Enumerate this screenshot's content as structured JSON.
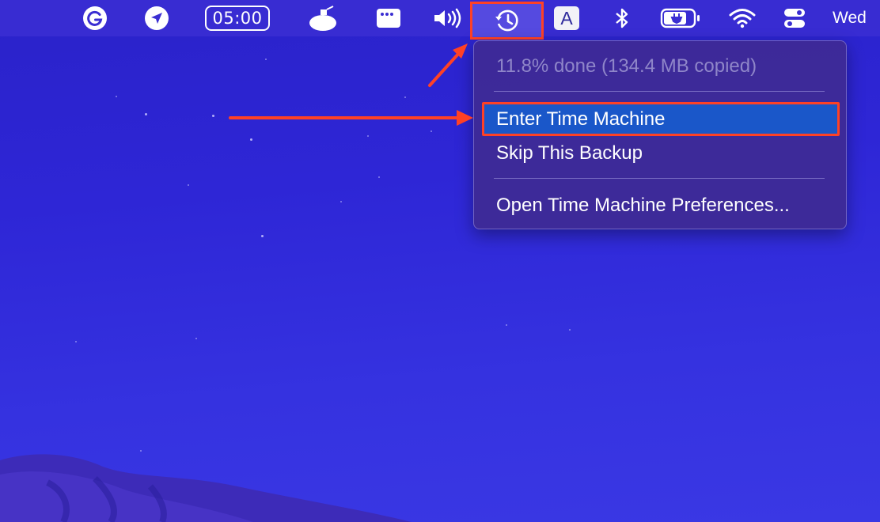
{
  "menubar": {
    "items": [
      {
        "name": "grammarly-icon"
      },
      {
        "name": "location-icon"
      },
      {
        "name": "timer",
        "label": "05:00"
      },
      {
        "name": "ufo-icon"
      },
      {
        "name": "window-icon"
      },
      {
        "name": "volume-icon"
      },
      {
        "name": "time-machine-icon",
        "highlighted": true
      },
      {
        "name": "input-source",
        "label": "A"
      },
      {
        "name": "bluetooth-icon"
      },
      {
        "name": "battery-charging-icon"
      },
      {
        "name": "wifi-icon"
      },
      {
        "name": "control-center-icon"
      }
    ],
    "day": "Wed"
  },
  "time_machine_menu": {
    "status": "11.8% done (134.4 MB copied)",
    "enter": "Enter Time Machine",
    "skip": "Skip This Backup",
    "preferences": "Open Time Machine Preferences..."
  },
  "colors": {
    "annotation": "#ff4125",
    "highlight": "#1a57c9",
    "menubar": "#3a2ed2",
    "desktop": "#2e26d6"
  }
}
